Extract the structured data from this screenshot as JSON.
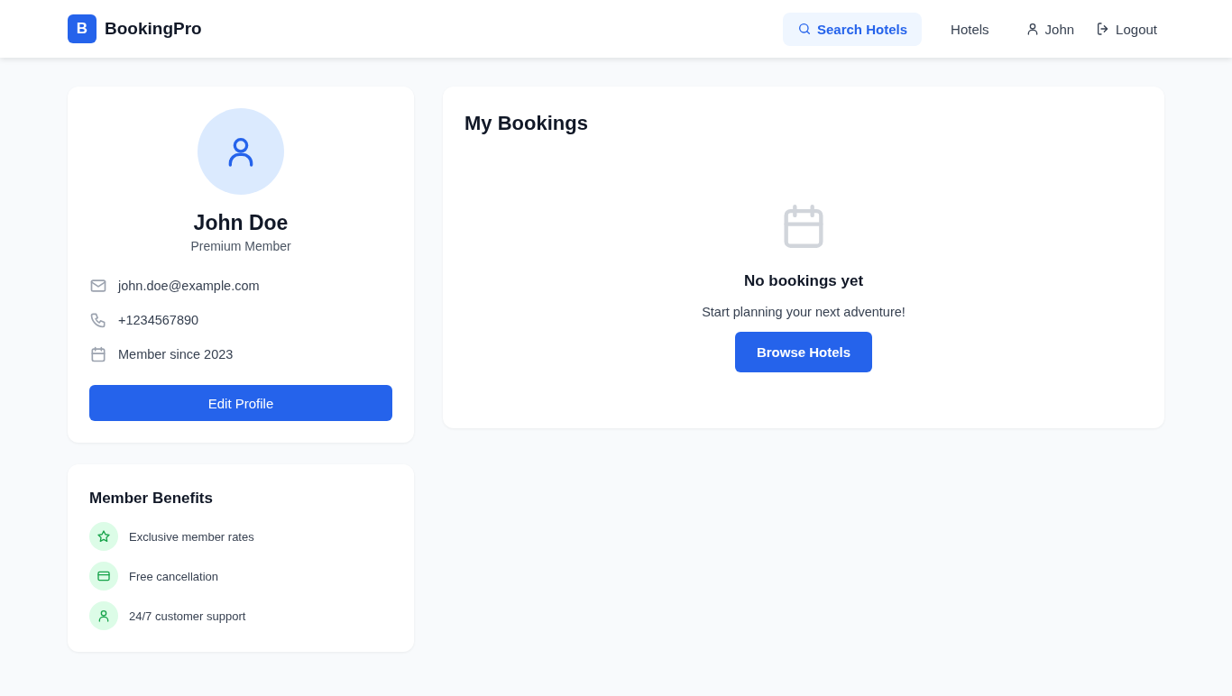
{
  "brand": {
    "logo_letter": "B",
    "name": "BookingPro"
  },
  "nav": [
    {
      "label": "Search Hotels",
      "kind": "search",
      "selected": true
    },
    {
      "label": "Hotels",
      "kind": "plain",
      "selected": false
    },
    {
      "label": "John",
      "kind": "user",
      "selected": false
    },
    {
      "label": "Logout",
      "kind": "logout",
      "selected": false
    }
  ],
  "profile": {
    "name": "John Doe",
    "tier": "Premium Member",
    "details": [
      {
        "kind": "mail",
        "text": "john.doe@example.com"
      },
      {
        "kind": "phone",
        "text": "+1234567890"
      },
      {
        "kind": "calendar",
        "text": "Member since 2023"
      }
    ],
    "button": "Edit Profile"
  },
  "benefits": {
    "title": "Member Benefits",
    "items": [
      {
        "kind": "star",
        "text": "Exclusive member rates"
      },
      {
        "kind": "card",
        "text": "Free cancellation"
      },
      {
        "kind": "user",
        "text": "24/7 customer support"
      }
    ]
  },
  "bookings": {
    "title": "My Bookings",
    "empty_title": "No bookings yet",
    "empty_text": "Start planning your next adventure!",
    "button": "Browse Hotels"
  }
}
